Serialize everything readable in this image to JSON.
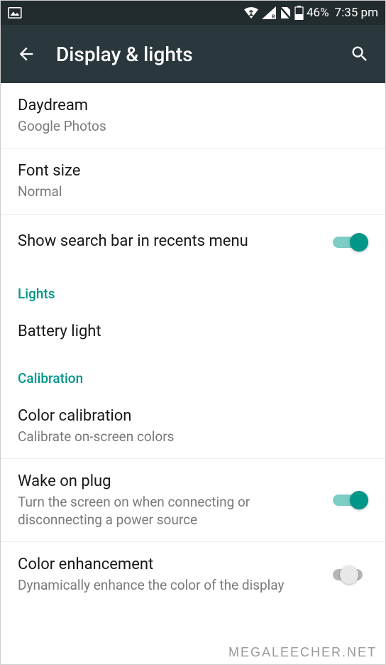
{
  "status": {
    "battery_pct": "46%",
    "time": "7:35 pm"
  },
  "header": {
    "title": "Display & lights"
  },
  "items": {
    "daydream": {
      "title": "Daydream",
      "sub": "Google Photos"
    },
    "fontsize": {
      "title": "Font size",
      "sub": "Normal"
    },
    "searchbar": {
      "title": "Show search bar in recents menu"
    },
    "batterylight": {
      "title": "Battery light"
    },
    "colorcal": {
      "title": "Color calibration",
      "sub": "Calibrate on-screen colors"
    },
    "wakeplug": {
      "title": "Wake on plug",
      "sub": "Turn the screen on when connecting or disconnecting a power source"
    },
    "colorenh": {
      "title": "Color enhancement",
      "sub": "Dynamically enhance the color of the display"
    }
  },
  "sections": {
    "lights": "Lights",
    "calibration": "Calibration"
  },
  "watermark": "MEGALEECHER.NET"
}
